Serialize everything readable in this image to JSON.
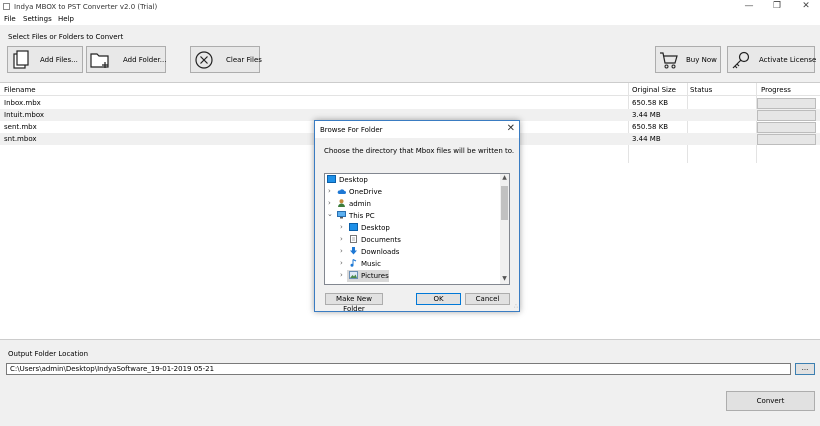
{
  "window": {
    "title": "Indya MBOX to PST Converter v2.0 (Trial)",
    "minimize_icon": "minimize-icon",
    "maximize_icon": "restore-icon",
    "close_icon": "close-icon"
  },
  "menu": {
    "items": [
      "File",
      "Settings",
      "Help"
    ]
  },
  "toolbar": {
    "section_label": "Select Files or Folders to Convert",
    "add_files": "Add Files...",
    "add_folder": "Add Folder...",
    "clear_files": "Clear Files",
    "buy_now": "Buy Now",
    "activate_license": "Activate License"
  },
  "grid": {
    "columns": [
      "Filename",
      "Original Size",
      "Status",
      "Progress"
    ],
    "rows": [
      {
        "filename": "Inbox.mbx",
        "size": "650.58 KB",
        "status": "",
        "progress": 0
      },
      {
        "filename": "Intuit.mbox",
        "size": "3.44 MB",
        "status": "",
        "progress": 0
      },
      {
        "filename": "sent.mbx",
        "size": "650.58 KB",
        "status": "",
        "progress": 0
      },
      {
        "filename": "snt.mbox",
        "size": "3.44 MB",
        "status": "",
        "progress": 0
      }
    ]
  },
  "output": {
    "label": "Output Folder Location",
    "path": "C:\\Users\\admin\\Desktop\\IndyaSoftware_19-01-2019 05-21",
    "browse_label": "...",
    "convert_label": "Convert"
  },
  "dialog": {
    "title": "Browse For Folder",
    "message": "Choose the directory that Mbox files will be written to.",
    "tree": [
      {
        "label": "Desktop",
        "icon": "desktop-folder-icon",
        "arrow": ""
      },
      {
        "label": "OneDrive",
        "icon": "cloud-icon",
        "arrow": ">"
      },
      {
        "label": "admin",
        "icon": "user-icon",
        "arrow": ">"
      },
      {
        "label": "This PC",
        "icon": "computer-icon",
        "arrow": "v"
      },
      {
        "label": "Desktop",
        "icon": "desktop-folder-icon",
        "arrow": ">"
      },
      {
        "label": "Documents",
        "icon": "documents-icon",
        "arrow": ">"
      },
      {
        "label": "Downloads",
        "icon": "download-icon",
        "arrow": ">"
      },
      {
        "label": "Music",
        "icon": "music-icon",
        "arrow": ">"
      },
      {
        "label": "Pictures",
        "icon": "pictures-icon",
        "arrow": ">"
      }
    ],
    "make_new_folder": "Make New Folder",
    "ok": "OK",
    "cancel": "Cancel"
  },
  "colors": {
    "accent": "#0078d7",
    "dialog_border": "#3a7cc2",
    "selected_row": "#d9d9d9"
  }
}
